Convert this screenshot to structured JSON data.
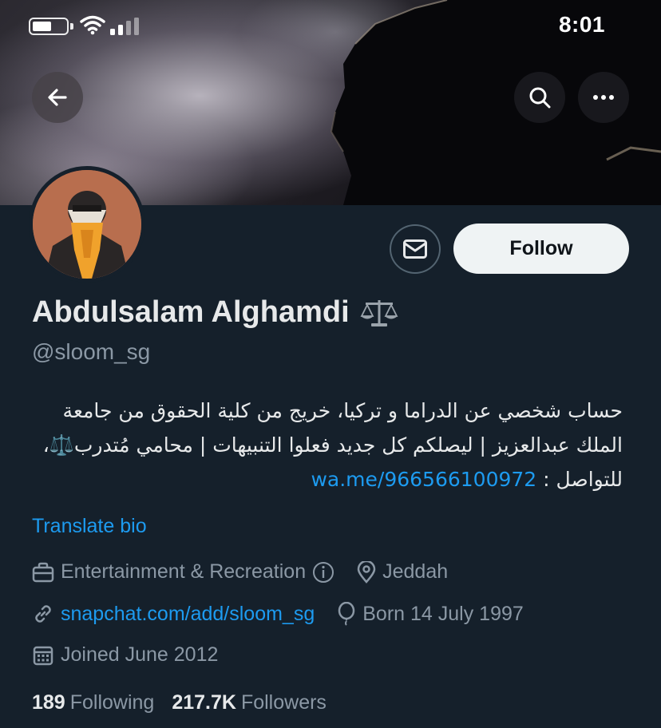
{
  "status_bar": {
    "time": "8:01",
    "battery_level": 0.6
  },
  "nav": {
    "back_icon": "arrow-left-icon",
    "search_icon": "search-icon",
    "more_icon": "more-horizontal-icon"
  },
  "profile": {
    "display_name": "Abdulsalam Alghamdi",
    "name_emoji": "⚖️",
    "handle": "@sloom_sg",
    "bio_text": "حساب شخصي عن الدراما و تركيا، خريج من كلية الحقوق من جامعة الملك عبدالعزيز | ليصلكم كل جديد فعلوا التنبيهات | محامي مُتدرب⚖️، للتواصل : ",
    "bio_link": "wa.me/966566100972",
    "translate_label": "Translate bio"
  },
  "actions": {
    "message_icon": "envelope-icon",
    "follow_label": "Follow"
  },
  "meta": {
    "category": "Entertainment & Recreation",
    "location": "Jeddah",
    "website": "snapchat.com/add/sloom_sg",
    "birthday": "Born 14 July 1997",
    "joined": "Joined June 2012"
  },
  "stats": {
    "following_count": "189",
    "following_label": "Following",
    "followers_count": "217.7K",
    "followers_label": "Followers"
  },
  "colors": {
    "background": "#15202b",
    "accent": "#1d9bf0",
    "secondary_text": "#8b98a5",
    "follow_button_bg": "#eff3f4"
  }
}
